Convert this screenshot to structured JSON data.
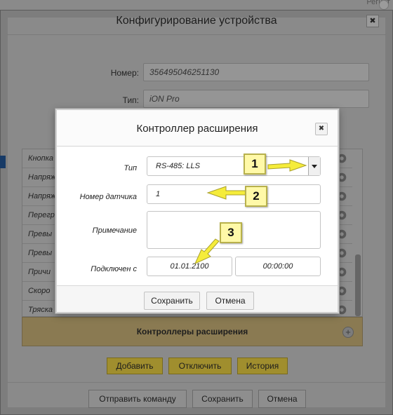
{
  "background": {
    "corner_text": "Регист"
  },
  "outer_dialog": {
    "title": "Конфигурирование устройства",
    "close": "✖",
    "number_label": "Номер:",
    "number_value": "356495046251130",
    "type_label": "Тип:",
    "type_value": "iON Pro",
    "list_rows": [
      "Кнопка",
      "Напряж",
      "Напряж",
      "Перегр",
      "Превы",
      "Превы",
      "Причи",
      "Скоро",
      "Тряска"
    ],
    "controllers_title": "Контроллеры расширения",
    "add_label": "Добавить",
    "disable_label": "Отключить",
    "history_label": "История",
    "send_command_label": "Отправить команду",
    "save_label": "Сохранить",
    "cancel_label": "Отмена"
  },
  "modal": {
    "title": "Контроллер расширения",
    "close": "✖",
    "type_label": "Тип",
    "type_value": "RS-485: LLS",
    "sensor_label": "Номер датчика",
    "sensor_value": "1",
    "note_label": "Примечание",
    "note_value": "",
    "connected_label": "Подключен с",
    "date_value": "01.01.2100",
    "time_value": "00:00:00",
    "save_label": "Сохранить",
    "cancel_label": "Отмена"
  },
  "callouts": [
    "1",
    "2",
    "3"
  ],
  "colors": {
    "callout_fill": "#fff9a8",
    "callout_border": "#b8b14c",
    "arrow_fill": "#f5ec3a",
    "controllers_bar": "#8a7a52",
    "yellow_button": "#a08e2e"
  }
}
